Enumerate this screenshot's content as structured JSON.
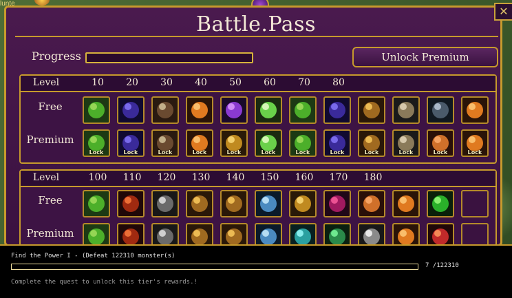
{
  "window": {
    "corner_text": "lunte"
  },
  "panel": {
    "title": "Battle.Pass",
    "progress_label": "Progress",
    "progress_fill": 0.0,
    "unlock_button": "Unlock Premium"
  },
  "tier_block_1": {
    "level_label": "Level",
    "levels": [
      "10",
      "20",
      "30",
      "40",
      "50",
      "60",
      "70",
      "80"
    ],
    "free_label": "Free",
    "premium_label": "Premium",
    "free_rewards": [
      "green-charm",
      "dark-orb",
      "bone-armor",
      "amber-egg",
      "purple-chest",
      "glow-orb",
      "green-charm",
      "dark-orb",
      "treasure-chest",
      "silver-key",
      "steel-helmet",
      "amber-egg"
    ],
    "premium_rewards": [
      "green-charm",
      "dark-orb",
      "bone-armor",
      "amber-egg",
      "gold-chest",
      "glow-orb",
      "green-charm",
      "dark-orb",
      "treasure-chest",
      "silver-key",
      "orange-armor",
      "amber-egg"
    ],
    "lock_label": "Lock"
  },
  "tier_block_2": {
    "level_label": "Level",
    "levels": [
      "100",
      "110",
      "120",
      "130",
      "140",
      "150",
      "160",
      "170",
      "180"
    ],
    "free_label": "Free",
    "premium_label": "Premium",
    "free_rewards": [
      "green-charm",
      "dragon-eye",
      "skull-helm",
      "treasure-chest",
      "treasure-chest",
      "potion-bottle",
      "gold-chest",
      "crimson-orb",
      "orange-armor",
      "amber-egg",
      "green-apple",
      ""
    ],
    "premium_rewards": [
      "green-charm",
      "dragon-eye",
      "skull-helm",
      "treasure-chest",
      "treasure-chest",
      "potion-bottle",
      "teal-armor",
      "green-orb",
      "silver-armor",
      "amber-egg",
      "red-shield",
      ""
    ]
  },
  "quest": {
    "title": "Find the Power I - (Defeat 122310 monster(s)",
    "progress_fill": 0.0,
    "count": "7 /122310",
    "desc": "Complete the quest to unlock this tier's rewards.!"
  },
  "colors": {
    "gold": "#c79a2c",
    "panel": "#4a1a4e",
    "text": "#f3e9d6"
  }
}
